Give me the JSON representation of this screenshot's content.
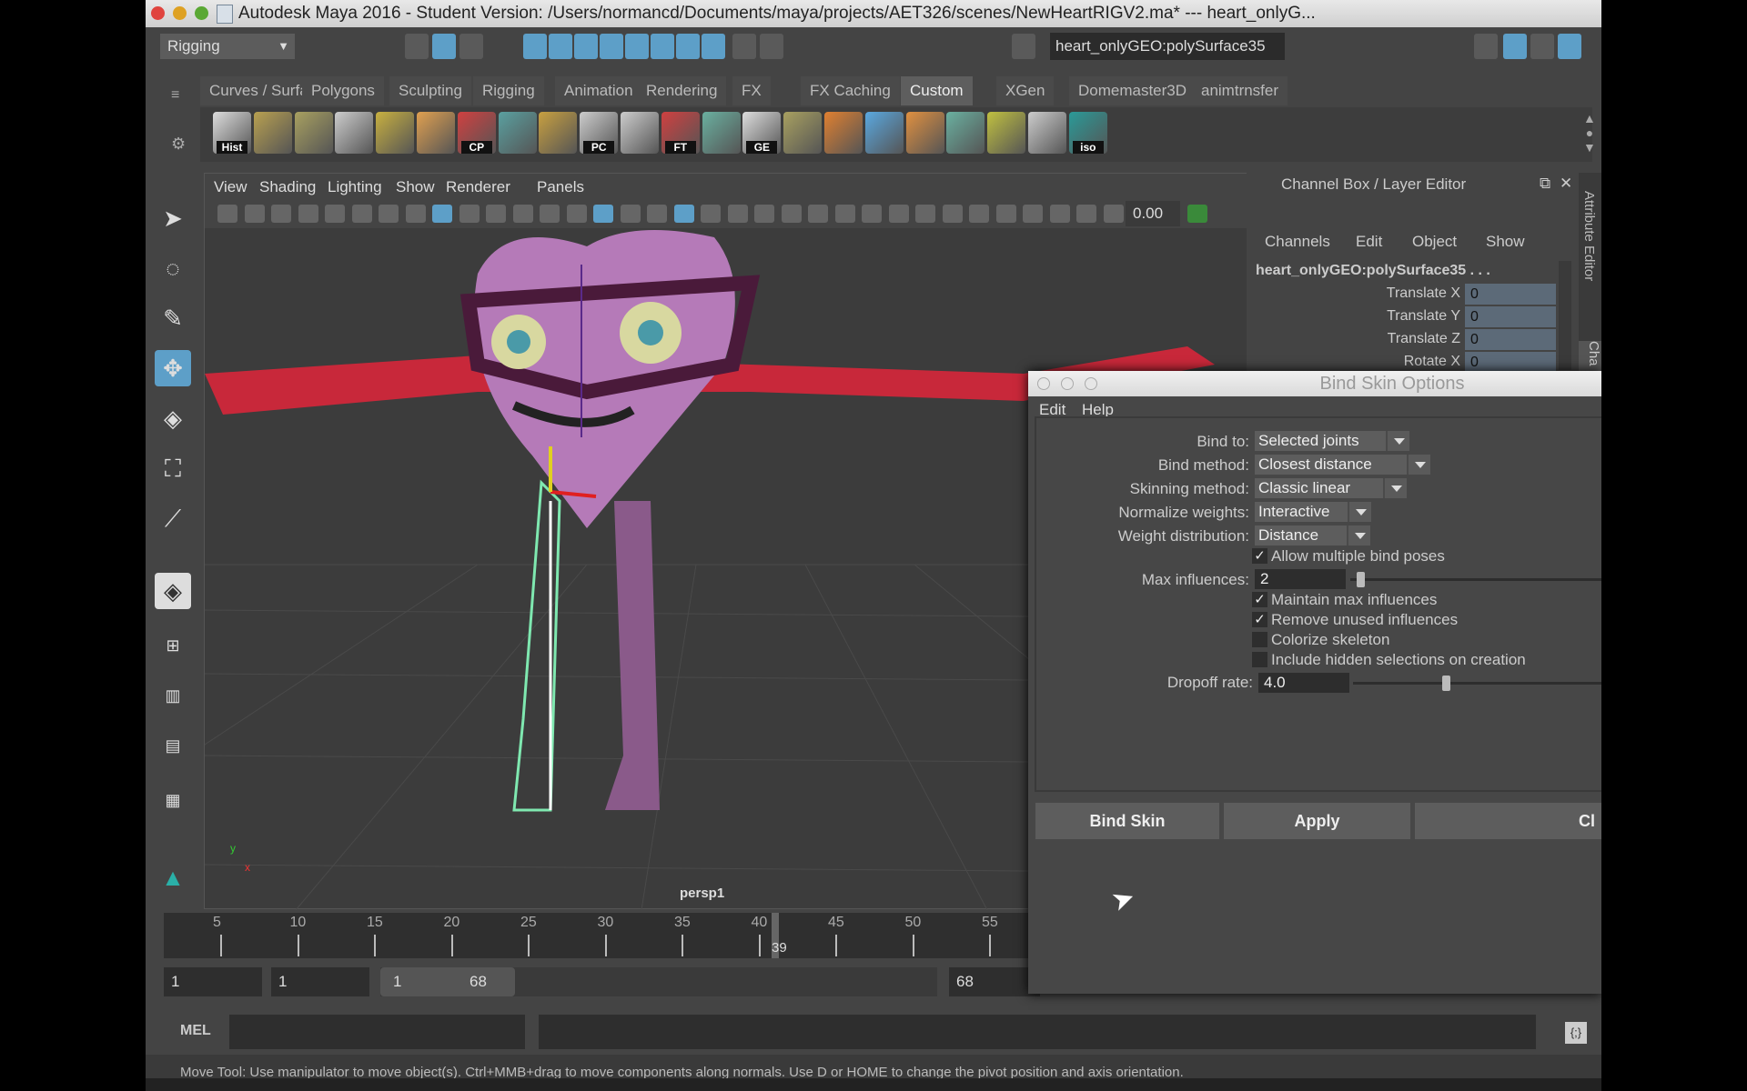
{
  "window": {
    "title": "Autodesk Maya 2016 - Student Version: /Users/normancd/Documents/maya/projects/AET326/scenes/NewHeartRIGV2.ma*   ---   heart_onlyG..."
  },
  "statusline": {
    "mode": "Rigging",
    "selection_field": "heart_onlyGEO:polySurface35"
  },
  "shelf_tabs": [
    "Curves / Surfaces",
    "Polygons",
    "Sculpting",
    "Rigging",
    "Animation",
    "Rendering",
    "FX",
    "FX Caching",
    "Custom",
    "XGen",
    "Domemaster3D",
    "animtrnsfer"
  ],
  "shelf_active": "Custom",
  "shelf_icons": [
    {
      "name": "hist",
      "label": "Hist"
    },
    {
      "name": "grid-mesh",
      "label": ""
    },
    {
      "name": "plane",
      "label": ""
    },
    {
      "name": "pencil",
      "label": ""
    },
    {
      "name": "uv-map",
      "label": ""
    },
    {
      "name": "cube",
      "label": ""
    },
    {
      "name": "axis",
      "label": "CP"
    },
    {
      "name": "node-editor",
      "label": ""
    },
    {
      "name": "lattice",
      "label": ""
    },
    {
      "name": "camera-pc",
      "label": "PC"
    },
    {
      "name": "brush",
      "label": ""
    },
    {
      "name": "axis",
      "label": "FT"
    },
    {
      "name": "checker-window",
      "label": ""
    },
    {
      "name": "window",
      "label": "GE"
    },
    {
      "name": "plane",
      "label": ""
    },
    {
      "name": "grid-orange",
      "label": ""
    },
    {
      "name": "paint-brush",
      "label": ""
    },
    {
      "name": "layers",
      "label": ""
    },
    {
      "name": "checker-window",
      "label": ""
    },
    {
      "name": "paint-disk",
      "label": ""
    },
    {
      "name": "bounding",
      "label": ""
    },
    {
      "name": "iso",
      "label": "iso"
    }
  ],
  "viewport": {
    "menu": [
      "View",
      "Shading",
      "Lighting",
      "Show",
      "Renderer",
      "Panels"
    ],
    "value_field": "0.00",
    "camera_label": "persp1",
    "axis_labels": {
      "y": "y",
      "x": "x"
    }
  },
  "channel_box": {
    "title": "Channel Box / Layer Editor",
    "menu": [
      "Channels",
      "Edit",
      "Object",
      "Show"
    ],
    "object": "heart_onlyGEO:polySurface35 . . .",
    "channels": [
      {
        "name": "Translate X",
        "value": "0"
      },
      {
        "name": "Translate Y",
        "value": "0"
      },
      {
        "name": "Translate Z",
        "value": "0"
      },
      {
        "name": "Rotate X",
        "value": "0"
      }
    ],
    "side_tabs": [
      "Attribute Editor",
      "Cha"
    ]
  },
  "timeline": {
    "ticks": [
      "5",
      "10",
      "15",
      "20",
      "25",
      "30",
      "35",
      "40",
      "45",
      "50",
      "55"
    ],
    "current_frame": "39"
  },
  "range": {
    "start": "1",
    "playback_start": "1",
    "slider_start": "1",
    "slider_end": "68",
    "playback_end": "68"
  },
  "cmdline": {
    "label": "MEL"
  },
  "helpline": "Move Tool: Use manipulator to move object(s). Ctrl+MMB+drag to move components along normals. Use D or HOME to change the pivot position and axis orientation.",
  "dialog": {
    "title": "Bind Skin Options",
    "menu": [
      "Edit",
      "Help"
    ],
    "bind_to": {
      "label": "Bind to:",
      "value": "Selected joints"
    },
    "bind_method": {
      "label": "Bind method:",
      "value": "Closest distance"
    },
    "skinning_method": {
      "label": "Skinning method:",
      "value": "Classic linear"
    },
    "normalize_weights": {
      "label": "Normalize weights:",
      "value": "Interactive"
    },
    "weight_distribution": {
      "label": "Weight distribution:",
      "value": "Distance"
    },
    "allow_multiple": {
      "label": "Allow multiple bind poses",
      "checked": true
    },
    "max_influences": {
      "label": "Max influences:",
      "value": "2"
    },
    "maintain_max": {
      "label": "Maintain max influences",
      "checked": true
    },
    "remove_unused": {
      "label": "Remove unused influences",
      "checked": true
    },
    "colorize": {
      "label": "Colorize skeleton",
      "checked": false
    },
    "include_hidden": {
      "label": "Include hidden selections on creation",
      "checked": false
    },
    "dropoff": {
      "label": "Dropoff rate:",
      "value": "4.0"
    },
    "buttons": {
      "bind": "Bind Skin",
      "apply": "Apply",
      "close": "Cl"
    }
  },
  "colors": {
    "accent": "#5d9fc8",
    "viewport_bg": "#3c3c3c",
    "heart": "#b57ab8",
    "arms": "#c8283a",
    "skin_wire": "#7fe8b0"
  }
}
